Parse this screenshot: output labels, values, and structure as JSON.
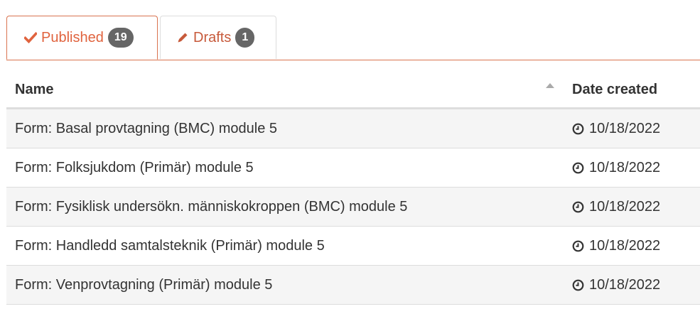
{
  "tabs": {
    "published": {
      "label": "Published",
      "count": "19",
      "icon": "check-icon",
      "color": "#e0633e"
    },
    "drafts": {
      "label": "Drafts",
      "count": "1",
      "icon": "pencil-icon",
      "color": "#c75a3b"
    }
  },
  "table": {
    "headers": {
      "name": "Name",
      "date": "Date created"
    },
    "sort": {
      "column": "name",
      "direction": "ascending"
    },
    "rows": [
      {
        "name": "Form: Basal provtagning (BMC) module 5",
        "date": "10/18/2022"
      },
      {
        "name": "Form: Folksjukdom (Primär) module 5",
        "date": "10/18/2022"
      },
      {
        "name": "Form: Fysiklisk undersökn. människokroppen (BMC) module 5",
        "date": "10/18/2022"
      },
      {
        "name": "Form: Handledd samtalsteknik (Primär) module 5",
        "date": "10/18/2022"
      },
      {
        "name": "Form: Venprovtagning (Primär) module 5",
        "date": "10/18/2022"
      }
    ]
  },
  "colors": {
    "accent": "#e0633e",
    "badge": "#666666",
    "stripe": "#f5f5f5"
  }
}
